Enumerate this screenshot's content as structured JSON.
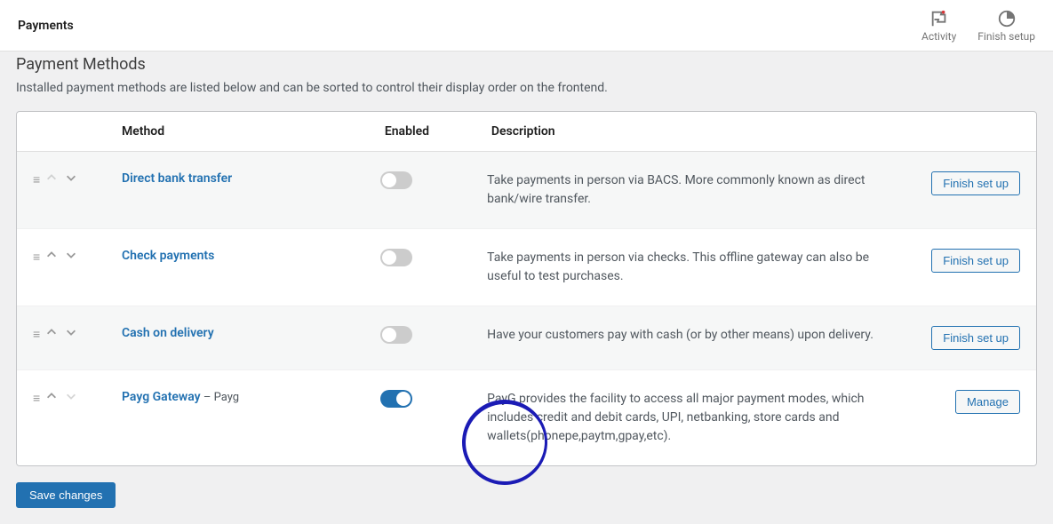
{
  "topbar": {
    "title": "Payments",
    "activity_label": "Activity",
    "finish_setup_label": "Finish setup"
  },
  "section": {
    "title": "Payment Methods",
    "description": "Installed payment methods are listed below and can be sorted to control their display order on the frontend."
  },
  "columns": {
    "method": "Method",
    "enabled": "Enabled",
    "description": "Description"
  },
  "methods": [
    {
      "name": "Direct bank transfer",
      "suffix": "",
      "enabled": false,
      "description": "Take payments in person via BACS. More commonly known as direct bank/wire transfer.",
      "action_label": "Finish set up",
      "up_dim": true,
      "down_dim": false
    },
    {
      "name": "Check payments",
      "suffix": "",
      "enabled": false,
      "description": "Take payments in person via checks. This offline gateway can also be useful to test purchases.",
      "action_label": "Finish set up",
      "up_dim": false,
      "down_dim": false
    },
    {
      "name": "Cash on delivery",
      "suffix": "",
      "enabled": false,
      "description": "Have your customers pay with cash (or by other means) upon delivery.",
      "action_label": "Finish set up",
      "up_dim": false,
      "down_dim": false
    },
    {
      "name": "Payg Gateway",
      "suffix": " – Payg",
      "enabled": true,
      "description": "PayG provides the facility to access all major payment modes, which includes credit and debit cards, UPI, netbanking, store cards and wallets(phonepe,paytm,gpay,etc).",
      "action_label": "Manage",
      "up_dim": false,
      "down_dim": true
    }
  ],
  "save_label": "Save changes"
}
